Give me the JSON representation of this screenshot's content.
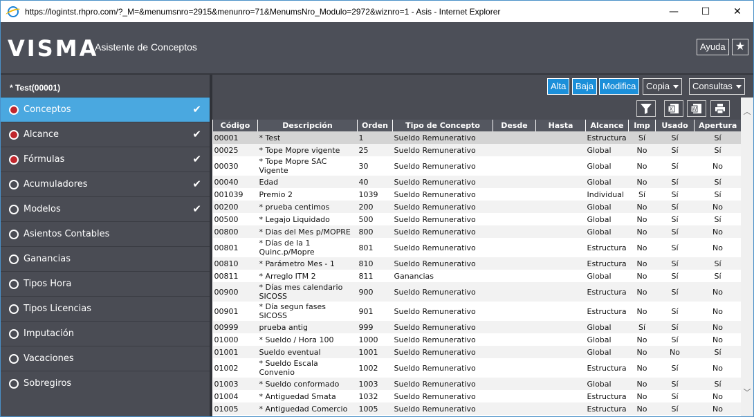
{
  "window": {
    "url": "https://logintst.rhpro.com/?_M=&menumsnro=2915&menunro=71&MenumsNro_Modulo=2972&wiznro=1 - Asis - Internet Explorer",
    "min": "—",
    "max": "☐",
    "close": "✕"
  },
  "header": {
    "logo": "VISMA",
    "title": "Asistente de Conceptos",
    "help": "Ayuda",
    "star": "★"
  },
  "sidebar": {
    "heading": "* Test(00001)",
    "items": [
      {
        "label": "Conceptos",
        "status": "red",
        "checked": true,
        "active": true
      },
      {
        "label": "Alcance",
        "status": "red",
        "checked": true
      },
      {
        "label": "Fórmulas",
        "status": "red",
        "checked": true
      },
      {
        "label": "Acumuladores",
        "status": "empty",
        "checked": true
      },
      {
        "label": "Modelos",
        "status": "empty",
        "checked": true
      },
      {
        "label": "Asientos Contables",
        "status": "empty"
      },
      {
        "label": "Ganancias",
        "status": "empty"
      },
      {
        "label": "Tipos Hora",
        "status": "empty"
      },
      {
        "label": "Tipos Licencias",
        "status": "empty"
      },
      {
        "label": "Imputación",
        "status": "empty"
      },
      {
        "label": "Vacaciones",
        "status": "empty"
      },
      {
        "label": "Sobregiros",
        "status": "empty"
      }
    ]
  },
  "toolbar": {
    "alta": "Alta",
    "baja": "Baja",
    "modifica": "Modifica",
    "copia": "Copia",
    "consultas": "Consultas"
  },
  "icons": [
    "filter-icon",
    "excel-icon",
    "word-icon",
    "print-icon"
  ],
  "table": {
    "columns": [
      "Código",
      "Descripción",
      "Orden",
      "Tipo de Concepto",
      "Desde",
      "Hasta",
      "Alcance",
      "Imp",
      "Usado",
      "Apertura"
    ],
    "rows": [
      [
        "00001",
        "* Test",
        "1",
        "Sueldo Remunerativo",
        "",
        "",
        "Estructura",
        "Sí",
        "Sí",
        "Sí"
      ],
      [
        "00025",
        "* Tope Mopre vigente",
        "25",
        "Sueldo Remunerativo",
        "",
        "",
        "Global",
        "No",
        "Sí",
        "Sí"
      ],
      [
        "00030",
        "* Tope Mopre SAC Vigente",
        "30",
        "Sueldo Remunerativo",
        "",
        "",
        "Global",
        "No",
        "Sí",
        "No"
      ],
      [
        "00040",
        "Edad",
        "40",
        "Sueldo Remunerativo",
        "",
        "",
        "Global",
        "No",
        "Sí",
        "Sí"
      ],
      [
        "001039",
        "Premio 2",
        "1039",
        "Sueldo Remunerativo",
        "",
        "",
        "Individual",
        "Sí",
        "Sí",
        "Sí"
      ],
      [
        "00200",
        "* prueba centimos",
        "200",
        "Sueldo Remunerativo",
        "",
        "",
        "Global",
        "No",
        "Sí",
        "No"
      ],
      [
        "00500",
        "* Legajo Liquidado",
        "500",
        "Sueldo Remunerativo",
        "",
        "",
        "Global",
        "No",
        "Sí",
        "Sí"
      ],
      [
        "00800",
        "* Dias del Mes p/MOPRE",
        "800",
        "Sueldo Remunerativo",
        "",
        "",
        "Global",
        "No",
        "Sí",
        "No"
      ],
      [
        "00801",
        "* Días de la 1 Quinc.p/Mopre",
        "801",
        "Sueldo Remunerativo",
        "",
        "",
        "Estructura",
        "No",
        "Sí",
        "No"
      ],
      [
        "00810",
        "* Parámetro Mes - 1",
        "810",
        "Sueldo Remunerativo",
        "",
        "",
        "Estructura",
        "No",
        "Sí",
        "Sí"
      ],
      [
        "00811",
        "* Arreglo ITM 2",
        "811",
        "Ganancias",
        "",
        "",
        "Global",
        "No",
        "Sí",
        "Sí"
      ],
      [
        "00900",
        "* Días mes calendario SICOSS",
        "900",
        "Sueldo Remunerativo",
        "",
        "",
        "Estructura",
        "No",
        "Sí",
        "No"
      ],
      [
        "00901",
        "* Día segun fases SICOSS",
        "901",
        "Sueldo Remunerativo",
        "",
        "",
        "Estructura",
        "No",
        "Sí",
        "No"
      ],
      [
        "00999",
        "prueba antig",
        "999",
        "Sueldo Remunerativo",
        "",
        "",
        "Global",
        "Sí",
        "Sí",
        "No"
      ],
      [
        "01000",
        "* Sueldo / Hora 100",
        "1000",
        "Sueldo Remunerativo",
        "",
        "",
        "Global",
        "No",
        "Sí",
        "No"
      ],
      [
        "01001",
        "Sueldo eventual",
        "1001",
        "Sueldo Remunerativo",
        "",
        "",
        "Global",
        "No",
        "No",
        "Sí"
      ],
      [
        "01002",
        "* Sueldo Escala Convenio",
        "1002",
        "Sueldo Remunerativo",
        "",
        "",
        "Estructura",
        "No",
        "Sí",
        "No"
      ],
      [
        "01003",
        "* Sueldo conformado",
        "1003",
        "Sueldo Remunerativo",
        "",
        "",
        "Global",
        "No",
        "Sí",
        "Sí"
      ],
      [
        "01004",
        "* Antiguedad Smata",
        "1032",
        "Sueldo Remunerativo",
        "",
        "",
        "Estructura",
        "No",
        "Sí",
        "No"
      ],
      [
        "01005",
        "* Antiguedad Comercio",
        "1005",
        "Sueldo Remunerativo",
        "",
        "",
        "Estructura",
        "No",
        "Sí",
        "No"
      ]
    ]
  }
}
